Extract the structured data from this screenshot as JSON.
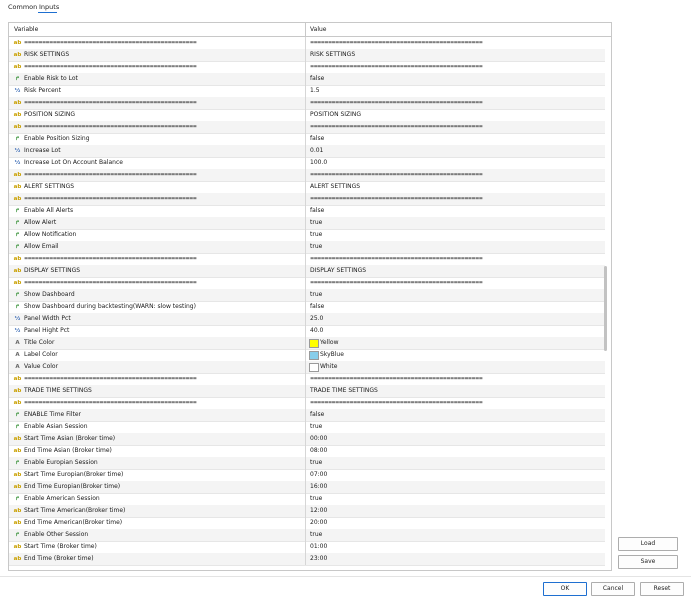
{
  "tabs": {
    "common": "Common",
    "inputs": "Inputs"
  },
  "columns": {
    "variable": "Variable",
    "value": "Value"
  },
  "icons": {
    "ab": {
      "glyph": "ab",
      "name": "string-type-icon"
    },
    "bool": {
      "glyph": "↱",
      "name": "boolean-type-icon"
    },
    "num": {
      "glyph": "½",
      "name": "number-type-icon"
    },
    "color": {
      "glyph": "A",
      "name": "color-type-icon"
    }
  },
  "rows": [
    {
      "icon": "ab",
      "name": "================================================",
      "value": "================================================",
      "sep": true
    },
    {
      "icon": "ab",
      "name": "RISK SETTINGS",
      "value": "RISK SETTINGS"
    },
    {
      "icon": "ab",
      "name": "================================================",
      "value": "================================================",
      "sep": true
    },
    {
      "icon": "bool",
      "name": "Enable Risk to Lot",
      "value": "false"
    },
    {
      "icon": "num",
      "name": "Risk Percent",
      "value": "1.5"
    },
    {
      "icon": "ab",
      "name": "================================================",
      "value": "================================================",
      "sep": true
    },
    {
      "icon": "ab",
      "name": "POSITION SIZING",
      "value": "POSITION SIZING"
    },
    {
      "icon": "ab",
      "name": "================================================",
      "value": "================================================",
      "sep": true
    },
    {
      "icon": "bool",
      "name": "Enable Position Sizing",
      "value": "false"
    },
    {
      "icon": "num",
      "name": "Increase Lot",
      "value": "0.01"
    },
    {
      "icon": "num",
      "name": "Increase Lot On Account Balance",
      "value": "100.0"
    },
    {
      "icon": "ab",
      "name": "================================================",
      "value": "================================================",
      "sep": true
    },
    {
      "icon": "ab",
      "name": "ALERT SETTINGS",
      "value": "ALERT SETTINGS"
    },
    {
      "icon": "ab",
      "name": "================================================",
      "value": "================================================",
      "sep": true
    },
    {
      "icon": "bool",
      "name": "Enable All Alerts",
      "value": "false"
    },
    {
      "icon": "bool",
      "name": "Allow Alert",
      "value": "true"
    },
    {
      "icon": "bool",
      "name": "Allow Notification",
      "value": "true"
    },
    {
      "icon": "bool",
      "name": "Allow Email",
      "value": "true"
    },
    {
      "icon": "ab",
      "name": "================================================",
      "value": "================================================",
      "sep": true
    },
    {
      "icon": "ab",
      "name": "DISPLAY SETTINGS",
      "value": "DISPLAY SETTINGS"
    },
    {
      "icon": "ab",
      "name": "================================================",
      "value": "================================================",
      "sep": true
    },
    {
      "icon": "bool",
      "name": "Show Dashboard",
      "value": "true"
    },
    {
      "icon": "bool",
      "name": "Show Dashboard during backtesting(WARN: slow testing)",
      "value": "false"
    },
    {
      "icon": "num",
      "name": "Panel Width Pct",
      "value": "25.0"
    },
    {
      "icon": "num",
      "name": "Panel Hight Pct",
      "value": "40.0"
    },
    {
      "icon": "color",
      "name": "Title Color",
      "value": "Yellow",
      "swatch": "#ffff00"
    },
    {
      "icon": "color",
      "name": "Label Color",
      "value": "SkyBlue",
      "swatch": "#87ceeb"
    },
    {
      "icon": "color",
      "name": "Value Color",
      "value": "White",
      "swatch": "#ffffff"
    },
    {
      "icon": "ab",
      "name": "================================================",
      "value": "================================================",
      "sep": true
    },
    {
      "icon": "ab",
      "name": "TRADE TIME SETTINGS",
      "value": "TRADE TIME SETTINGS"
    },
    {
      "icon": "ab",
      "name": "================================================",
      "value": "================================================",
      "sep": true
    },
    {
      "icon": "bool",
      "name": "ENABLE Time Filter",
      "value": "false"
    },
    {
      "icon": "bool",
      "name": "Enable Asian Session",
      "value": "true"
    },
    {
      "icon": "ab",
      "name": "Start Time Asian (Broker time)",
      "value": "00:00"
    },
    {
      "icon": "ab",
      "name": "End Time Asian (Broker time)",
      "value": "08:00"
    },
    {
      "icon": "bool",
      "name": "Enable Europian Session",
      "value": "true"
    },
    {
      "icon": "ab",
      "name": "Start Time Europian(Broker time)",
      "value": "07:00"
    },
    {
      "icon": "ab",
      "name": "End Time Europian(Broker time)",
      "value": "16:00"
    },
    {
      "icon": "bool",
      "name": "Enable American Session",
      "value": "true"
    },
    {
      "icon": "ab",
      "name": "Start Time American(Broker time)",
      "value": "12:00"
    },
    {
      "icon": "ab",
      "name": "End Time American(Broker time)",
      "value": "20:00"
    },
    {
      "icon": "bool",
      "name": "Enable Other Session",
      "value": "true"
    },
    {
      "icon": "ab",
      "name": "Start Time (Broker time)",
      "value": "01:00"
    },
    {
      "icon": "ab",
      "name": "End Time (Broker time)",
      "value": "23:00"
    }
  ],
  "buttons": {
    "load": "Load",
    "save": "Save",
    "ok": "OK",
    "cancel": "Cancel",
    "reset": "Reset"
  }
}
